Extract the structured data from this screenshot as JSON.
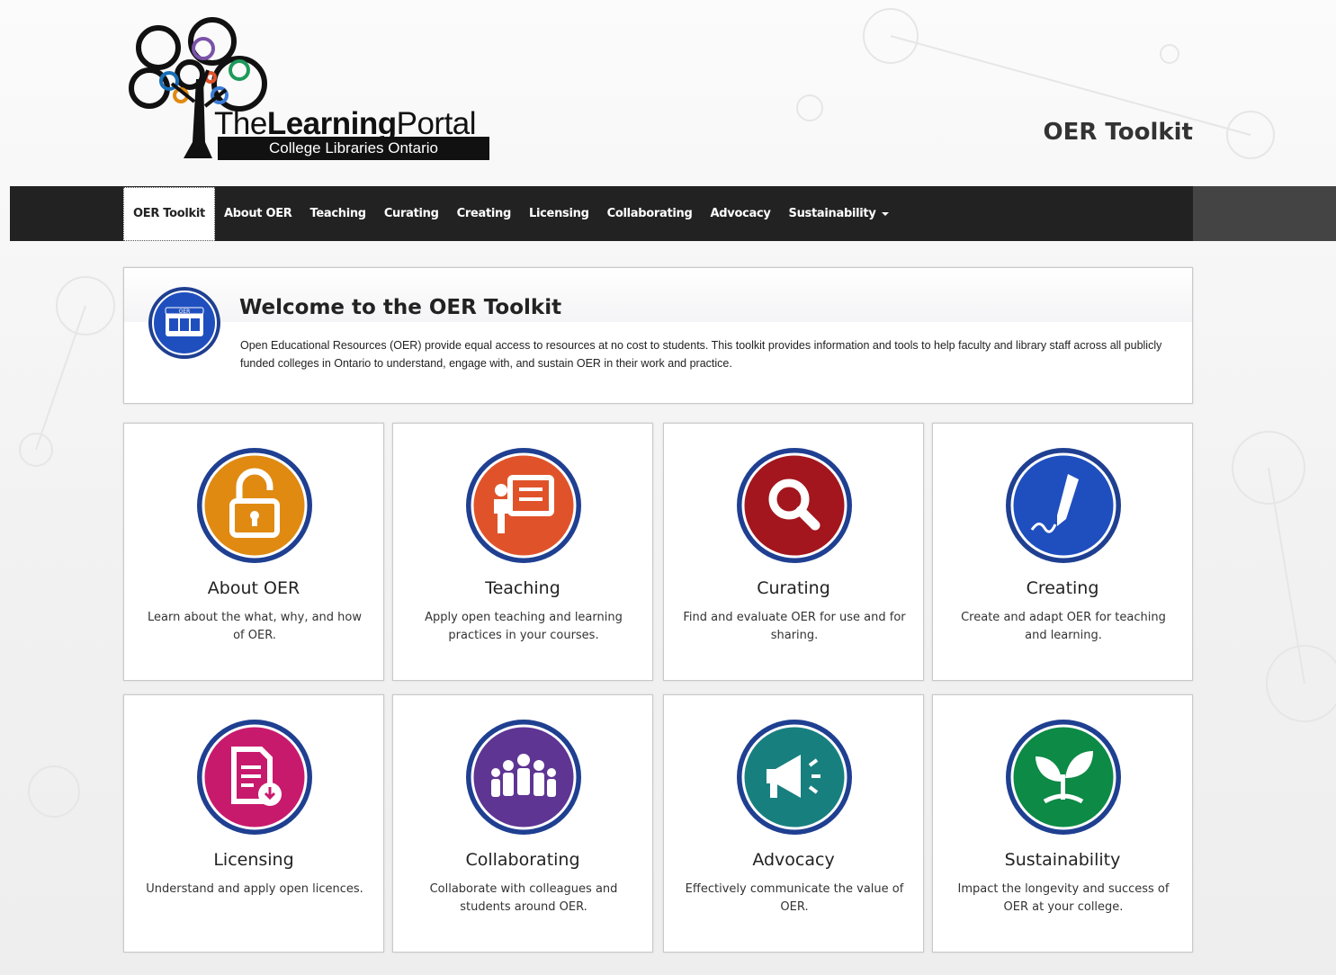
{
  "logo": {
    "title_light_1": "The",
    "title_bold": "Learning",
    "title_light_2": "Portal",
    "subtitle": "College Libraries Ontario"
  },
  "site_title": "OER Toolkit",
  "nav": {
    "items": [
      {
        "label": "OER Toolkit",
        "active": true
      },
      {
        "label": "About OER"
      },
      {
        "label": "Teaching"
      },
      {
        "label": "Curating"
      },
      {
        "label": "Creating"
      },
      {
        "label": "Licensing"
      },
      {
        "label": "Collaborating"
      },
      {
        "label": "Advocacy"
      },
      {
        "label": "Sustainability",
        "dropdown": true
      }
    ]
  },
  "welcome": {
    "title": "Welcome to the OER Toolkit",
    "icon_label": "OER",
    "text": "Open Educational Resources (OER) provide equal access to resources at no cost to students. This toolkit provides information and tools to help faculty and library staff across all publicly funded colleges in Ontario to understand, engage with, and sustain OER in their work and practice."
  },
  "cards": [
    {
      "title": "About OER",
      "desc": "Learn about the what, why, and how of OER.",
      "icon": "unlocked-padlock-icon",
      "color": "#e08a12"
    },
    {
      "title": "Teaching",
      "desc": "Apply open teaching and learning practices in your courses.",
      "icon": "presenter-board-icon",
      "color": "#e0532a"
    },
    {
      "title": "Curating",
      "desc": "Find and evaluate OER for use and for sharing.",
      "icon": "magnifier-icon",
      "color": "#a3161d"
    },
    {
      "title": "Creating",
      "desc": "Create and adapt OER for teaching and learning.",
      "icon": "pen-signature-icon",
      "color": "#1f4fbf"
    },
    {
      "title": "Licensing",
      "desc": "Understand and apply open licences.",
      "icon": "document-download-icon",
      "color": "#c81a6d"
    },
    {
      "title": "Collaborating",
      "desc": "Collaborate with colleagues and students around OER.",
      "icon": "group-people-icon",
      "color": "#5e3593"
    },
    {
      "title": "Advocacy",
      "desc": "Effectively communicate the value of OER.",
      "icon": "megaphone-icon",
      "color": "#17807f"
    },
    {
      "title": "Sustainability",
      "desc": "Impact the longevity and success of OER at your college.",
      "icon": "sprout-icon",
      "color": "#0d8a45"
    }
  ],
  "colors": {
    "nav_bg": "#222222",
    "ring": "#1f3f91",
    "page_bg": "#f3f3f3"
  }
}
